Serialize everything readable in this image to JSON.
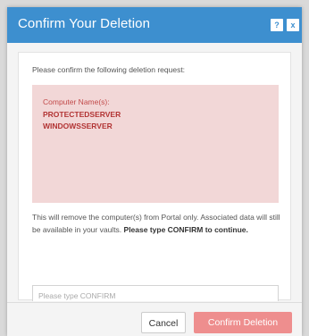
{
  "dialog": {
    "title": "Confirm Your Deletion",
    "help_label": "?",
    "close_label": "x"
  },
  "body": {
    "prompt": "Please confirm the following deletion request:",
    "alert": {
      "label": "Computer Name(s):",
      "items": [
        "PROTECTEDSERVER",
        "WINDOWSSERVER"
      ]
    },
    "warning_text": "This will remove the computer(s) from Portal only. Associated data will still be available in your vaults. ",
    "warning_strong": "Please type CONFIRM to continue.",
    "input": {
      "placeholder": "Please type CONFIRM",
      "value": ""
    }
  },
  "footer": {
    "cancel_label": "Cancel",
    "confirm_label": "Confirm Deletion"
  },
  "colors": {
    "title_bar": "#3d8fcf",
    "alert_bg": "#f2d7d7",
    "alert_text": "#b23434",
    "confirm_button": "#ee8e8e"
  },
  "icons": {
    "help": "help-icon",
    "close": "close-icon"
  }
}
